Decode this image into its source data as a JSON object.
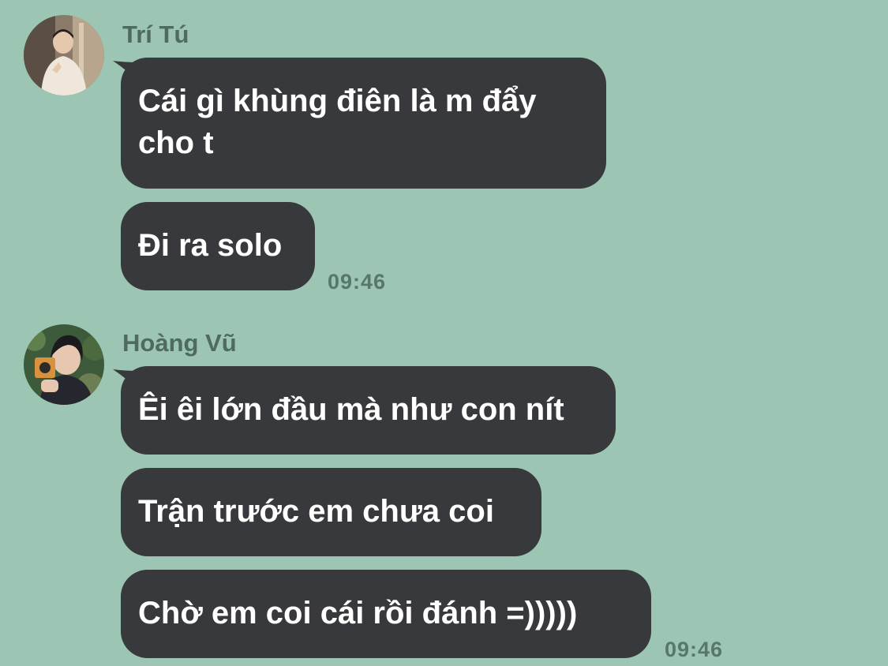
{
  "groups": [
    {
      "sender": "Trí Tú",
      "messages": [
        {
          "text": "Cái gì khùng điên là m đẩy cho t"
        },
        {
          "text": "Đi ra solo"
        }
      ],
      "time": "09:46"
    },
    {
      "sender": "Hoàng Vũ",
      "messages": [
        {
          "text": "Êi êi lớn đầu mà như con nít"
        },
        {
          "text": "Trận trước em chưa coi"
        },
        {
          "text": "Chờ em coi cái rồi đánh =)))))"
        }
      ],
      "time": "09:46"
    }
  ],
  "colors": {
    "background": "#9cc6b3",
    "bubble": "#38393c",
    "bubble_text": "#ffffff",
    "sender_name": "#4f6b60",
    "timestamp": "#57776b"
  }
}
